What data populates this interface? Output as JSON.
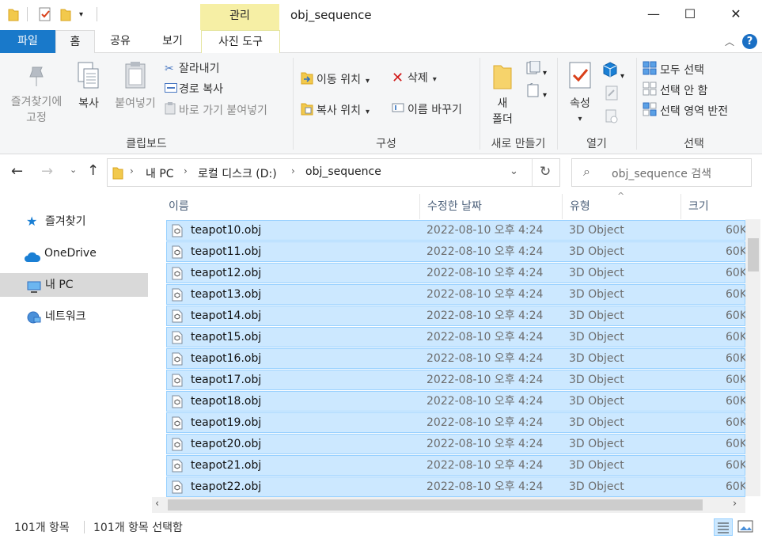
{
  "window": {
    "title": "obj_sequence",
    "contextual_tab_group": "관리",
    "minimize": "—",
    "maximize": "☐",
    "close": "✕"
  },
  "tabs": {
    "file": "파일",
    "home": "홈",
    "share": "공유",
    "view": "보기",
    "picture_tools": "사진 도구"
  },
  "ribbon": {
    "clipboard": {
      "group_label": "클립보드",
      "pin_line1": "즐겨찾기에",
      "pin_line2": "고정",
      "copy": "복사",
      "paste": "붙여넣기",
      "cut": "잘라내기",
      "copy_path": "경로 복사",
      "paste_shortcut": "바로 가기 붙여넣기"
    },
    "organize": {
      "group_label": "구성",
      "move_to": "이동 위치",
      "copy_to": "복사 위치",
      "delete": "삭제",
      "rename": "이름 바꾸기"
    },
    "new": {
      "group_label": "새로 만들기",
      "new_folder_line1": "새",
      "new_folder_line2": "폴더"
    },
    "open": {
      "group_label": "열기",
      "properties": "속성"
    },
    "select": {
      "group_label": "선택",
      "select_all": "모두 선택",
      "select_none": "선택 안 함",
      "invert": "선택 영역 반전"
    }
  },
  "address": {
    "segments": [
      "내 PC",
      "로컬 디스크 (D:)",
      "obj_sequence"
    ],
    "search_placeholder": "obj_sequence 검색"
  },
  "nav": {
    "items": [
      "즐겨찾기",
      "OneDrive",
      "내 PC",
      "네트워크"
    ]
  },
  "columns": {
    "name": "이름",
    "date": "수정한 날짜",
    "type": "유형",
    "size": "크기"
  },
  "files": [
    {
      "name": "teapot10.obj",
      "date": "2022-08-10 오후 4:24",
      "type": "3D Object",
      "size": "60K"
    },
    {
      "name": "teapot11.obj",
      "date": "2022-08-10 오후 4:24",
      "type": "3D Object",
      "size": "60K"
    },
    {
      "name": "teapot12.obj",
      "date": "2022-08-10 오후 4:24",
      "type": "3D Object",
      "size": "60K"
    },
    {
      "name": "teapot13.obj",
      "date": "2022-08-10 오후 4:24",
      "type": "3D Object",
      "size": "60K"
    },
    {
      "name": "teapot14.obj",
      "date": "2022-08-10 오후 4:24",
      "type": "3D Object",
      "size": "60K"
    },
    {
      "name": "teapot15.obj",
      "date": "2022-08-10 오후 4:24",
      "type": "3D Object",
      "size": "60K"
    },
    {
      "name": "teapot16.obj",
      "date": "2022-08-10 오후 4:24",
      "type": "3D Object",
      "size": "60K"
    },
    {
      "name": "teapot17.obj",
      "date": "2022-08-10 오후 4:24",
      "type": "3D Object",
      "size": "60K"
    },
    {
      "name": "teapot18.obj",
      "date": "2022-08-10 오후 4:24",
      "type": "3D Object",
      "size": "60K"
    },
    {
      "name": "teapot19.obj",
      "date": "2022-08-10 오후 4:24",
      "type": "3D Object",
      "size": "60K"
    },
    {
      "name": "teapot20.obj",
      "date": "2022-08-10 오후 4:24",
      "type": "3D Object",
      "size": "60K"
    },
    {
      "name": "teapot21.obj",
      "date": "2022-08-10 오후 4:24",
      "type": "3D Object",
      "size": "60K"
    },
    {
      "name": "teapot22.obj",
      "date": "2022-08-10 오후 4:24",
      "type": "3D Object",
      "size": "60K"
    }
  ],
  "status": {
    "count": "101개 항목",
    "selected": "101개 항목 선택함"
  },
  "colors": {
    "file_tab": "#1979ca",
    "context_tab": "#f6efa5",
    "selection_fill": "#cce8ff",
    "selection_border": "#99d1ff"
  }
}
